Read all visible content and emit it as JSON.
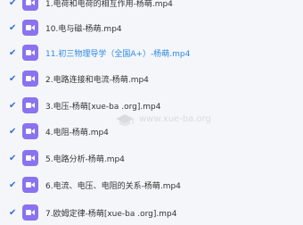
{
  "files": [
    {
      "name": "1.电荷和电荷的相互作用-杨萌.mp4",
      "active": false
    },
    {
      "name": "10.电与磁-杨萌.mp4",
      "active": false
    },
    {
      "name": "11.初三物理导学（全国A+）-杨萌.mp4",
      "active": true
    },
    {
      "name": "2.电路连接和电流-杨萌.mp4",
      "active": false
    },
    {
      "name": "3.电压-杨萌[xue-ba .org].mp4",
      "active": false
    },
    {
      "name": "4.电阻-杨萌.mp4",
      "active": false
    },
    {
      "name": "5.电路分析-杨萌.mp4",
      "active": false
    },
    {
      "name": "6.电流、电压、电阻的关系-杨萌.mp4",
      "active": false
    },
    {
      "name": "7.欧姆定律-杨萌[xue-ba .org].mp4",
      "active": false
    }
  ],
  "watermark": {
    "text": "www.xue-ba.org"
  },
  "icons": {
    "check": "check-icon",
    "video": "video-file-icon"
  },
  "colors": {
    "check": "#2f6fd8",
    "video_icon_bg": "#8a72f0",
    "active_text": "#2f8ae5"
  }
}
